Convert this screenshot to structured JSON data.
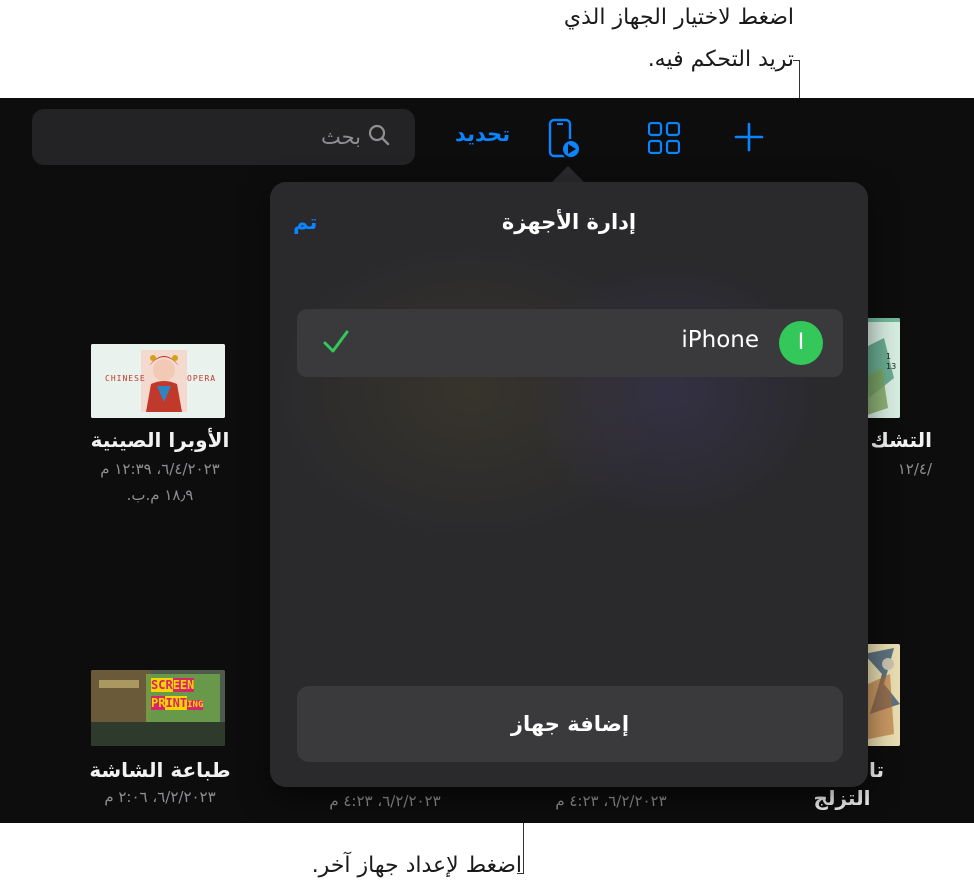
{
  "callouts": {
    "top_line1": "اضغط لاختيار الجهاز الذي",
    "top_line2": "تريد التحكم فيه.",
    "bottom": "اضغط لإعداد جهاز آخر."
  },
  "toolbar": {
    "search_placeholder": "بحث",
    "select_label": "تحديد"
  },
  "popover": {
    "title": "إدارة الأجهزة",
    "done_label": "تم",
    "device": {
      "name": "iPhone",
      "initial": "I",
      "selected": true
    },
    "add_device_label": "إضافة جهاز"
  },
  "documents": [
    {
      "title": "الأوبرا الصينية",
      "date": "٦/٤/٢٠٢٣، ١٢:٣٩ م",
      "size": "١٨٫٩ م.ب."
    },
    {
      "title": "التشك",
      "date": "/١٢/٤"
    },
    {
      "title": "طباعة الشاشة",
      "date": "٦/٢/٢٠٢٣، ٢:٠٦ م"
    },
    {
      "title": "",
      "date": "٦/٢/٢٠٢٣، ٤:٢٣ م"
    },
    {
      "title": "",
      "date": "٦/٢/٢٠٢٣، ٤:٢٣ م"
    },
    {
      "title_line1": "تا",
      "title_line2": "التزلج"
    }
  ],
  "thumbnails": {
    "opera_text_left": "CHINESE",
    "opera_text_right": "OPERA",
    "screen_printing_lines": [
      "SCR",
      "EEN",
      "PR",
      "INT",
      "ING"
    ]
  },
  "colors": {
    "accent": "#0a84ff",
    "check": "#34c759",
    "avatar": "#34c759"
  }
}
